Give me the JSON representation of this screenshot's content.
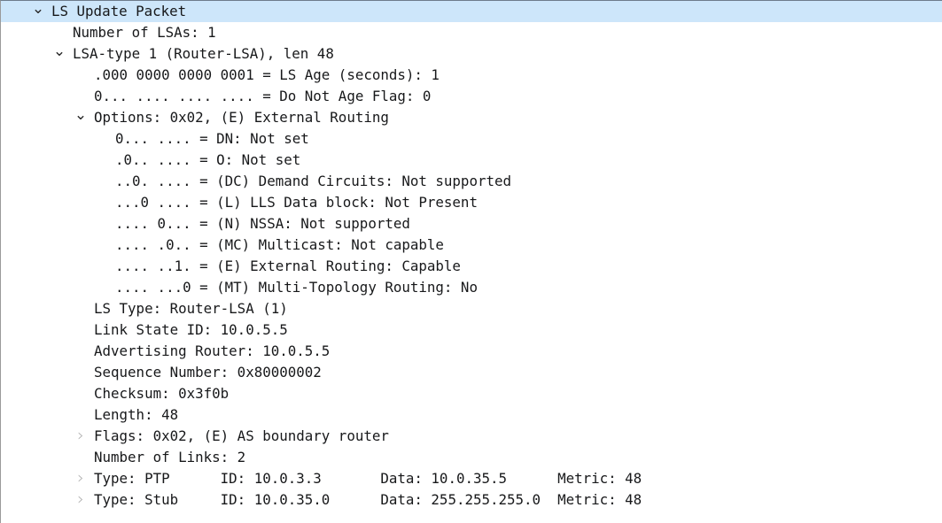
{
  "panel": {
    "name": "packet-details-tree",
    "selection_color": "#cde6fa",
    "background_color": "#ffffff",
    "text_color": "#17181a",
    "collapsed_arrow_color": "#a9a9a9",
    "expanded_arrow_color": "#2b2b2b"
  },
  "rows": [
    {
      "text": "LS Update Packet",
      "indent": 1,
      "twisty": "expanded",
      "selected": true,
      "name": "tree-row-ls-update-packet"
    },
    {
      "text": "Number of LSAs: 1",
      "indent": 2,
      "twisty": "none",
      "selected": false,
      "name": "tree-row-number-of-lsas"
    },
    {
      "text": "LSA-type 1 (Router-LSA), len 48",
      "indent": 2,
      "twisty": "expanded",
      "selected": false,
      "name": "tree-row-lsa-type-1"
    },
    {
      "text": ".000 0000 0000 0001 = LS Age (seconds): 1",
      "indent": 3,
      "twisty": "none",
      "selected": false,
      "name": "tree-row-ls-age"
    },
    {
      "text": "0... .... .... .... = Do Not Age Flag: 0",
      "indent": 3,
      "twisty": "none",
      "selected": false,
      "name": "tree-row-do-not-age-flag"
    },
    {
      "text": "Options: 0x02, (E) External Routing",
      "indent": 3,
      "twisty": "expanded",
      "selected": false,
      "name": "tree-row-options"
    },
    {
      "text": "0... .... = DN: Not set",
      "indent": 4,
      "twisty": "none",
      "selected": false,
      "name": "tree-row-option-dn"
    },
    {
      "text": ".0.. .... = O: Not set",
      "indent": 4,
      "twisty": "none",
      "selected": false,
      "name": "tree-row-option-o"
    },
    {
      "text": "..0. .... = (DC) Demand Circuits: Not supported",
      "indent": 4,
      "twisty": "none",
      "selected": false,
      "name": "tree-row-option-dc"
    },
    {
      "text": "...0 .... = (L) LLS Data block: Not Present",
      "indent": 4,
      "twisty": "none",
      "selected": false,
      "name": "tree-row-option-l"
    },
    {
      "text": ".... 0... = (N) NSSA: Not supported",
      "indent": 4,
      "twisty": "none",
      "selected": false,
      "name": "tree-row-option-n"
    },
    {
      "text": ".... .0.. = (MC) Multicast: Not capable",
      "indent": 4,
      "twisty": "none",
      "selected": false,
      "name": "tree-row-option-mc"
    },
    {
      "text": ".... ..1. = (E) External Routing: Capable",
      "indent": 4,
      "twisty": "none",
      "selected": false,
      "name": "tree-row-option-e"
    },
    {
      "text": ".... ...0 = (MT) Multi-Topology Routing: No",
      "indent": 4,
      "twisty": "none",
      "selected": false,
      "name": "tree-row-option-mt"
    },
    {
      "text": "LS Type: Router-LSA (1)",
      "indent": 3,
      "twisty": "none",
      "selected": false,
      "name": "tree-row-ls-type"
    },
    {
      "text": "Link State ID: 10.0.5.5",
      "indent": 3,
      "twisty": "none",
      "selected": false,
      "name": "tree-row-link-state-id"
    },
    {
      "text": "Advertising Router: 10.0.5.5",
      "indent": 3,
      "twisty": "none",
      "selected": false,
      "name": "tree-row-advertising-router"
    },
    {
      "text": "Sequence Number: 0x80000002",
      "indent": 3,
      "twisty": "none",
      "selected": false,
      "name": "tree-row-sequence-number"
    },
    {
      "text": "Checksum: 0x3f0b",
      "indent": 3,
      "twisty": "none",
      "selected": false,
      "name": "tree-row-checksum"
    },
    {
      "text": "Length: 48",
      "indent": 3,
      "twisty": "none",
      "selected": false,
      "name": "tree-row-length"
    },
    {
      "text": "Flags: 0x02, (E) AS boundary router",
      "indent": 3,
      "twisty": "collapsed",
      "selected": false,
      "name": "tree-row-flags"
    },
    {
      "text": "Number of Links: 2",
      "indent": 3,
      "twisty": "none",
      "selected": false,
      "name": "tree-row-number-of-links"
    },
    {
      "text": "Type: PTP      ID: 10.0.3.3       Data: 10.0.35.5      Metric: 48",
      "indent": 3,
      "twisty": "collapsed",
      "selected": false,
      "name": "tree-row-link-ptp"
    },
    {
      "text": "Type: Stub     ID: 10.0.35.0      Data: 255.255.255.0  Metric: 48",
      "indent": 3,
      "twisty": "collapsed",
      "selected": false,
      "name": "tree-row-link-stub"
    }
  ]
}
